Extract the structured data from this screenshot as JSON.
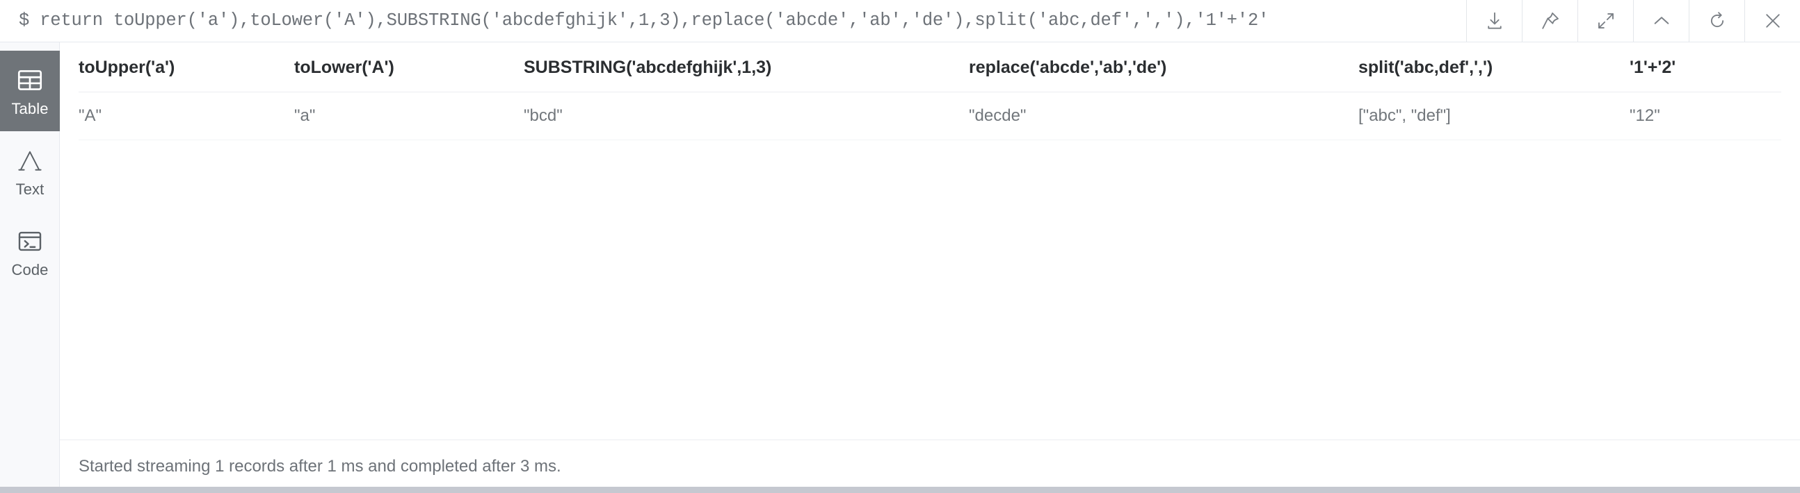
{
  "query_bar": {
    "prompt": "$",
    "query": "$ return toUpper('a'),toLower('A'),SUBSTRING('abcdefghijk',1,3),replace('abcde','ab','de'),split('abc,def',','),'1'+'2'",
    "toolbar": [
      {
        "name": "download-icon",
        "label": "Download"
      },
      {
        "name": "pin-icon",
        "label": "Pin"
      },
      {
        "name": "expand-icon",
        "label": "Expand"
      },
      {
        "name": "chevron-up-icon",
        "label": "Collapse"
      },
      {
        "name": "refresh-icon",
        "label": "Rerun"
      },
      {
        "name": "close-icon",
        "label": "Close"
      }
    ]
  },
  "sidebar": {
    "items": [
      {
        "label": "Table",
        "icon": "table-icon",
        "active": true
      },
      {
        "label": "Text",
        "icon": "text-a-icon",
        "active": false
      },
      {
        "label": "Code",
        "icon": "code-terminal-icon",
        "active": false
      }
    ]
  },
  "result_table": {
    "columns": [
      "toUpper('a')",
      "toLower('A')",
      "SUBSTRING('abcdefghijk',1,3)",
      "replace('abcde','ab','de')",
      "split('abc,def',',')",
      "'1'+'2'"
    ],
    "rows": [
      [
        "\"A\"",
        "\"a\"",
        "\"bcd\"",
        "\"decde\"",
        "[\"abc\", \"def\"]",
        "\"12\""
      ]
    ]
  },
  "status_bar": {
    "message": "Started streaming 1 records after 1 ms and completed after 3 ms."
  },
  "colors": {
    "active_sidebar_bg": "#6f7479",
    "sidebar_bg": "#f8f9fb",
    "text_muted": "#6d7278",
    "header_text": "#2b2e31",
    "border": "#e6e9ee",
    "grip": "#c5c8d0"
  }
}
